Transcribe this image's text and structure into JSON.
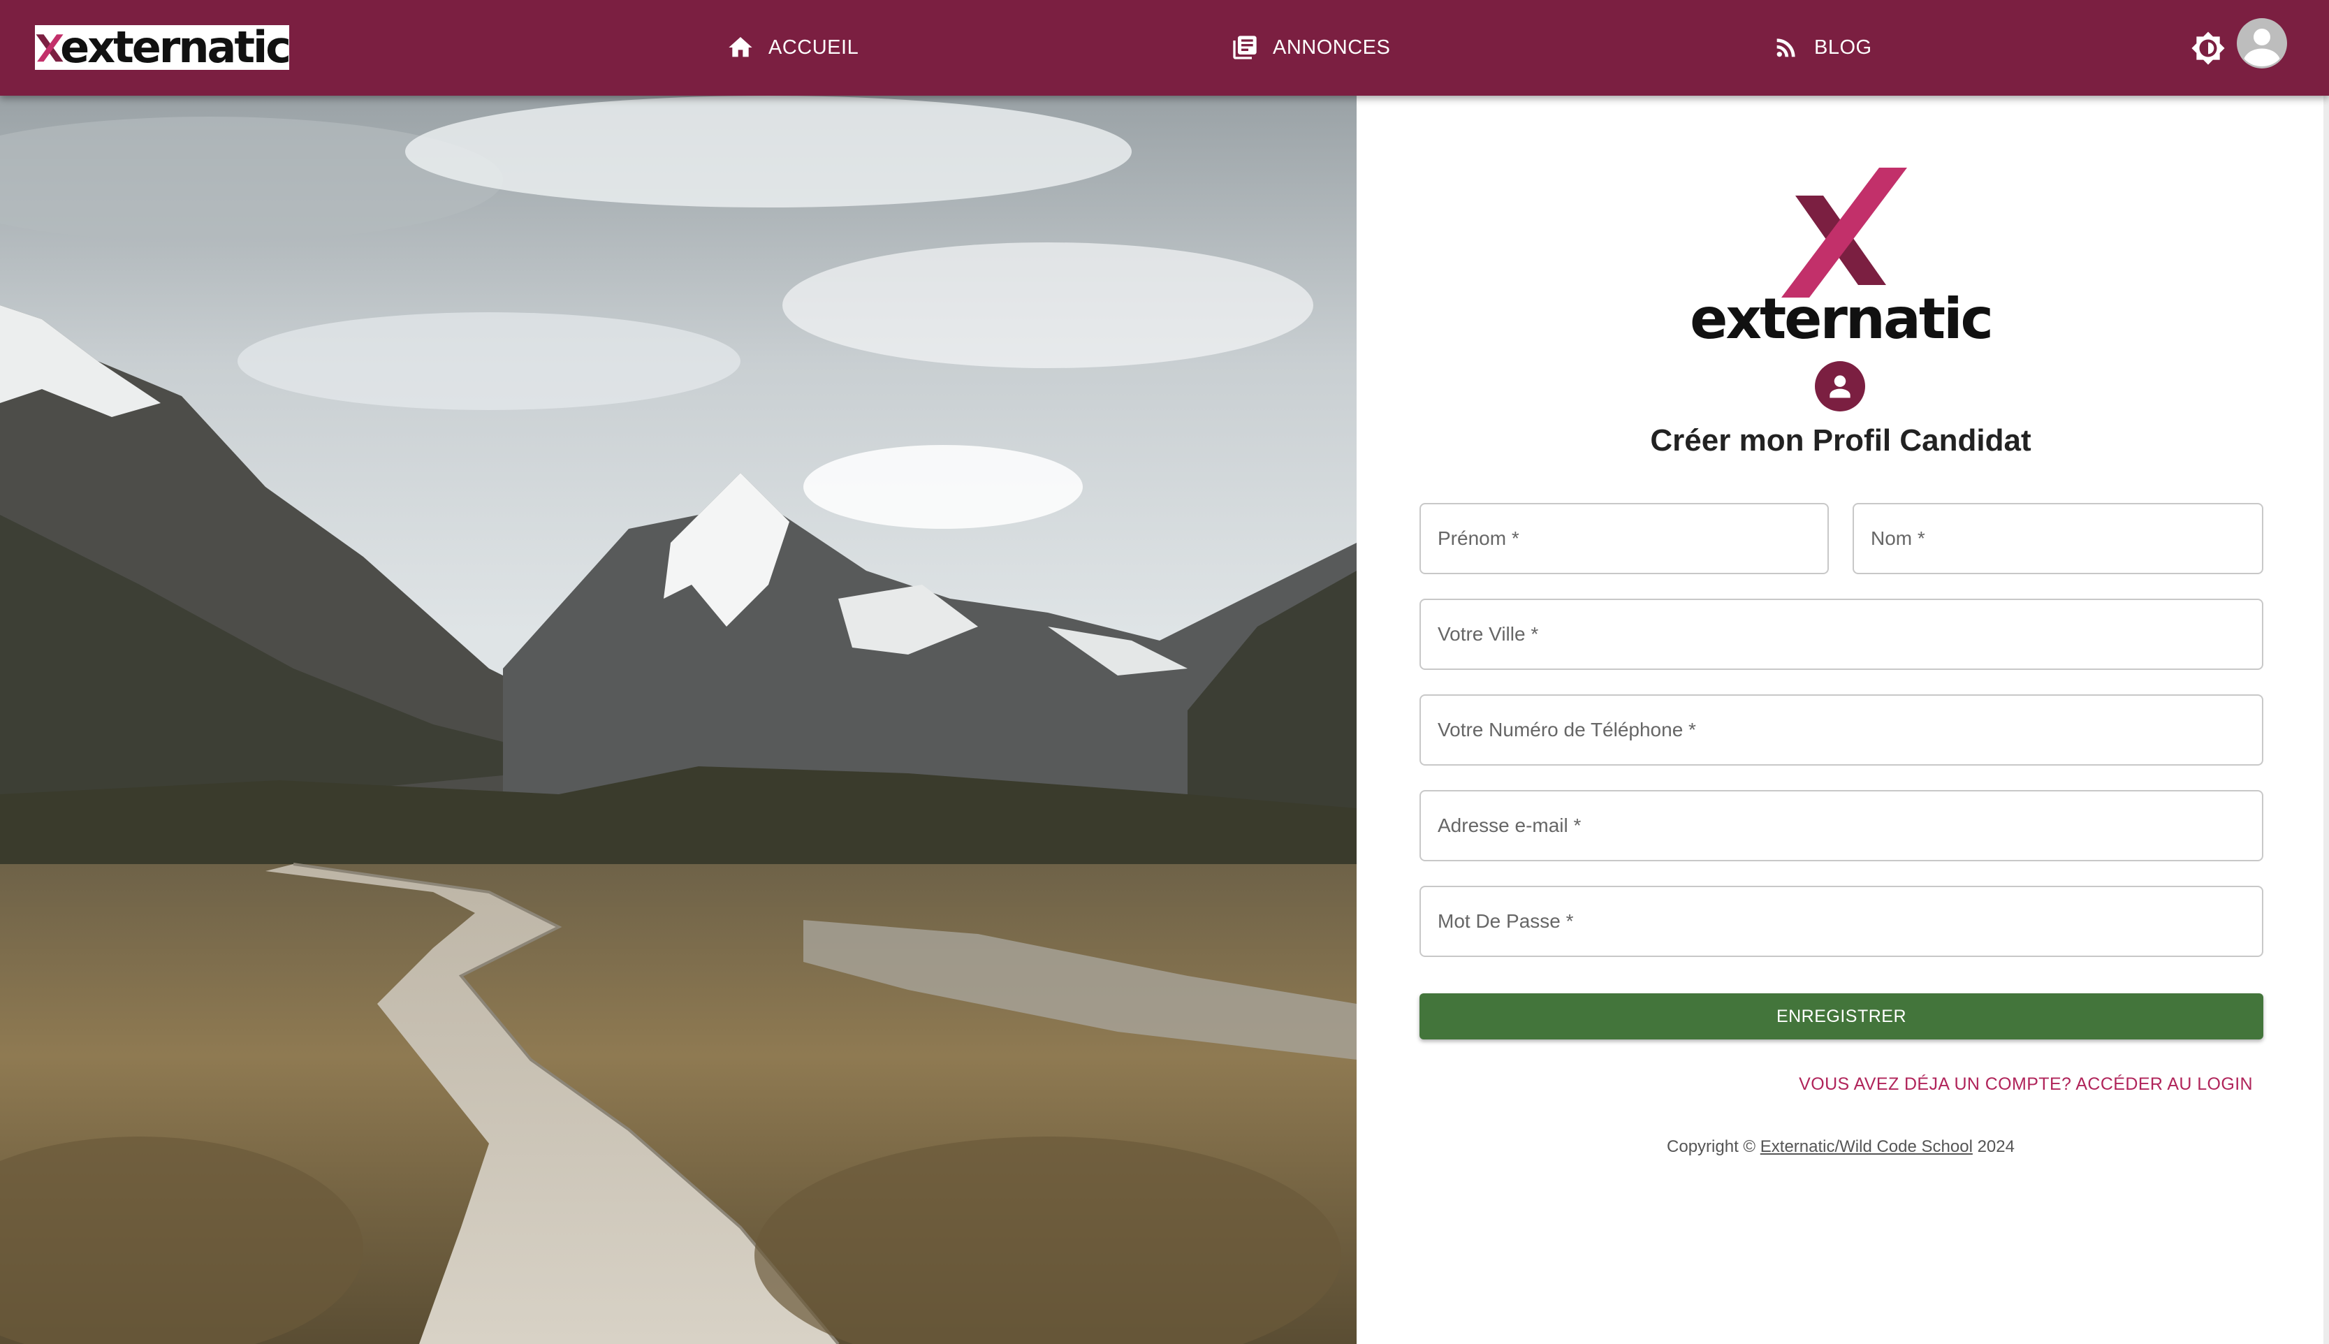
{
  "brand": {
    "name": "externatic"
  },
  "nav": {
    "items": [
      {
        "label": "ACCUEIL",
        "icon": "home-icon"
      },
      {
        "label": "ANNONCES",
        "icon": "library-books-icon"
      },
      {
        "label": "BLOG",
        "icon": "rss-feed-icon"
      }
    ],
    "theme_icon": "brightness-icon",
    "avatar_icon": "account-circle-icon"
  },
  "form": {
    "logo_text": "externatic",
    "title": "Créer mon Profil Candidat",
    "fields": {
      "first_name": {
        "placeholder": "Prénom *",
        "value": ""
      },
      "last_name": {
        "placeholder": "Nom *",
        "value": ""
      },
      "city": {
        "placeholder": "Votre Ville *",
        "value": ""
      },
      "phone": {
        "placeholder": "Votre Numéro de Téléphone *",
        "value": ""
      },
      "email": {
        "placeholder": "Adresse e-mail *",
        "value": ""
      },
      "password": {
        "placeholder": "Mot De Passe *",
        "value": ""
      }
    },
    "submit_label": "ENREGISTRER",
    "login_link": "VOUS AVEZ DÉJA UN COMPTE? ACCÉDER AU LOGIN"
  },
  "footer": {
    "prefix": "Copyright ©",
    "link": "Externatic/Wild Code School",
    "year": "2024"
  },
  "colors": {
    "primary": "#7b1f41",
    "accent": "#b0245a",
    "button": "#43753b"
  }
}
